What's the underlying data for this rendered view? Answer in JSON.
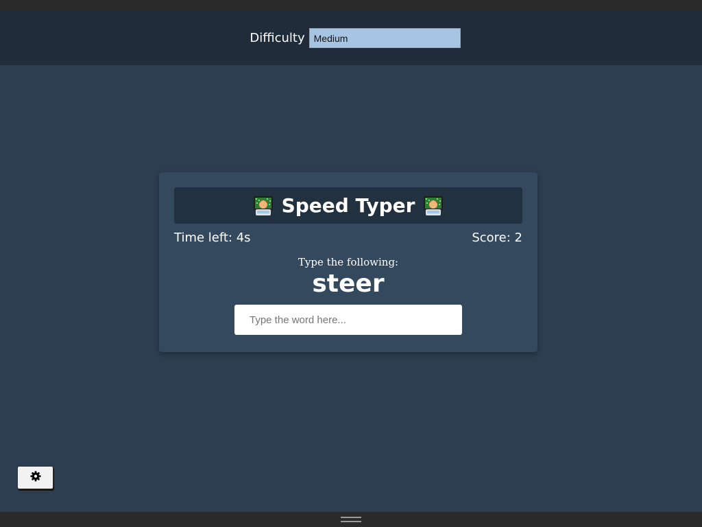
{
  "header": {
    "difficulty_label": "Difficulty",
    "difficulty_value": "Medium"
  },
  "game": {
    "title": "Speed Typer",
    "title_icon": "technologist-emoji-icon",
    "time_left": "Time left: 4s",
    "score": "Score: 2",
    "prompt_label": "Type the following:",
    "target_word": "steer",
    "input_placeholder": "Type the word here..."
  },
  "controls": {
    "settings_icon": "gear-icon"
  },
  "colors": {
    "background": "#2d3e50",
    "header_bg": "#202c39",
    "card_bg": "#34495e",
    "banner_bg": "#223140",
    "select_bg": "#a7c5e3"
  }
}
